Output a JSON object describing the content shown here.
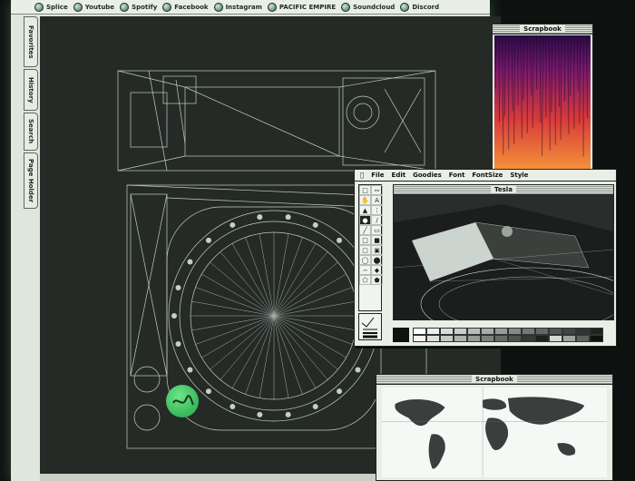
{
  "bookmarks": [
    "Splice",
    "Youtube",
    "Spotify",
    "Facebook",
    "Instagram",
    "PACIFIC EMPIRE",
    "Soundcloud",
    "Discord"
  ],
  "side_tabs": [
    "Favorites",
    "History",
    "Search",
    "Page Holder"
  ],
  "scrapbook_top": {
    "title": "Scrapbook"
  },
  "paint": {
    "menu": [
      "File",
      "Edit",
      "Goodies",
      "Font",
      "FontSize",
      "Style"
    ],
    "canvas_title": "Tesla"
  },
  "scrapbook_bottom": {
    "title": "Scrapbook"
  },
  "status_text": "",
  "colors": {
    "screen_bg": "#0d1210",
    "window_bg": "#e9eee6",
    "viewport_bg": "#252a27",
    "wireframe": "#cfe0d6",
    "sticker": "#2fc057"
  }
}
